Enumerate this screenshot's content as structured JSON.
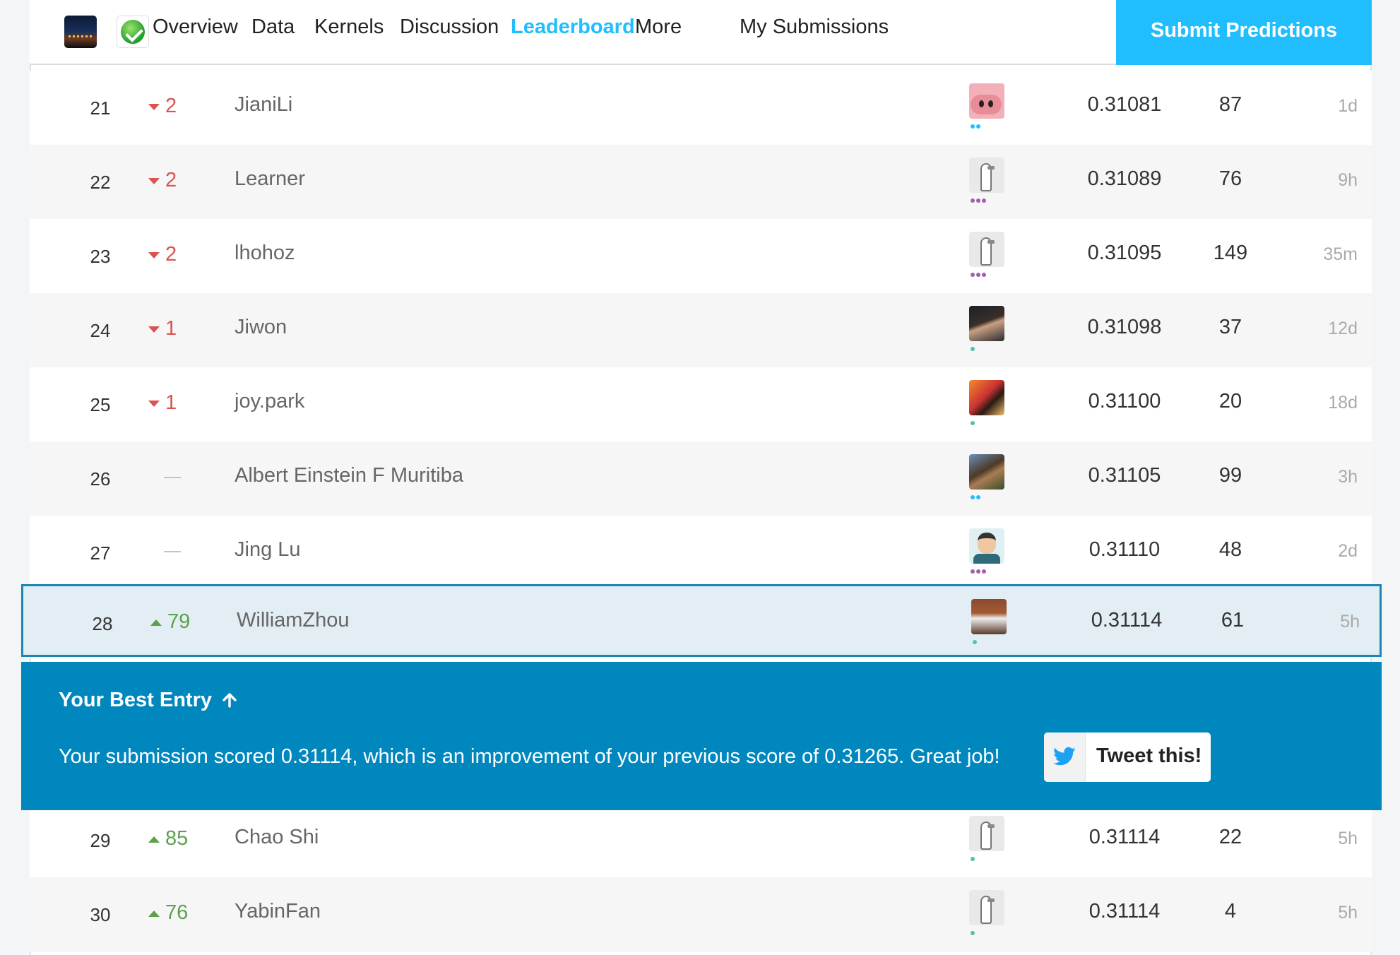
{
  "nav": {
    "thumbnails": [
      "competition-city-thumbnail",
      "sberbank-logo"
    ],
    "tabs": [
      "Overview",
      "Data",
      "Kernels",
      "Discussion",
      "Leaderboard",
      "More"
    ],
    "active_tab": "Leaderboard",
    "my_submissions": "My Submissions",
    "submit": "Submit Predictions"
  },
  "colors": {
    "accent": "#20beff",
    "banner": "#0087be",
    "down": "#d9534f",
    "up": "#5ba14a"
  },
  "rows": [
    {
      "rank": "21",
      "change": "2",
      "direction": "down",
      "team": "JianiLi",
      "avatar": "pig-avatar",
      "dots": [
        "#20beff",
        "#20beff"
      ],
      "score": "0.31081",
      "entries": "87",
      "last": "1d"
    },
    {
      "rank": "22",
      "change": "2",
      "direction": "down",
      "team": "Learner",
      "avatar": "default-goose-avatar",
      "dots": [
        "#a45bb4",
        "#a45bb4",
        "#a45bb4"
      ],
      "score": "0.31089",
      "entries": "76",
      "last": "9h"
    },
    {
      "rank": "23",
      "change": "2",
      "direction": "down",
      "team": "lhohoz",
      "avatar": "default-goose-avatar",
      "dots": [
        "#a45bb4",
        "#a45bb4",
        "#a45bb4"
      ],
      "score": "0.31095",
      "entries": "149",
      "last": "35m"
    },
    {
      "rank": "24",
      "change": "1",
      "direction": "down",
      "team": "Jiwon",
      "avatar": "photo-avatar",
      "dots": [
        "#4fc3a0"
      ],
      "score": "0.31098",
      "entries": "37",
      "last": "12d"
    },
    {
      "rank": "25",
      "change": "1",
      "direction": "down",
      "team": "joy.park",
      "avatar": "photo-avatar",
      "dots": [
        "#4fc3a0"
      ],
      "score": "0.31100",
      "entries": "20",
      "last": "18d"
    },
    {
      "rank": "26",
      "change": "",
      "direction": "none",
      "team": "Albert Einstein F Muritiba",
      "avatar": "photo-avatar",
      "dots": [
        "#20beff",
        "#20beff"
      ],
      "score": "0.31105",
      "entries": "99",
      "last": "3h"
    },
    {
      "rank": "27",
      "change": "",
      "direction": "none",
      "team": "Jing Lu",
      "avatar": "cartoon-avatar",
      "dots": [
        "#a45bb4",
        "#a45bb4",
        "#a45bb4"
      ],
      "score": "0.31110",
      "entries": "48",
      "last": "2d"
    },
    {
      "rank": "28",
      "change": "79",
      "direction": "up",
      "team": "WilliamZhou",
      "avatar": "photo-avatar",
      "dots": [
        "#4fc3a0"
      ],
      "score": "0.31114",
      "entries": "61",
      "last": "5h",
      "is_me": true
    },
    {
      "rank": "29",
      "change": "85",
      "direction": "up",
      "team": "Chao Shi",
      "avatar": "default-goose-avatar",
      "dots": [
        "#4fc3a0"
      ],
      "score": "0.31114",
      "entries": "22",
      "last": "5h"
    },
    {
      "rank": "30",
      "change": "76",
      "direction": "up",
      "team": "YabinFan",
      "avatar": "default-goose-avatar",
      "dots": [
        "#4fc3a0"
      ],
      "score": "0.31114",
      "entries": "4",
      "last": "5h"
    }
  ],
  "banner": {
    "title": "Your Best Entry",
    "arrow_icon": "arrow-up-icon",
    "message": "Your submission scored 0.31114, which is an improvement of your previous score of 0.31265. Great job!",
    "tweet_label": "Tweet this!",
    "tweet_icon": "twitter-bird-icon"
  }
}
